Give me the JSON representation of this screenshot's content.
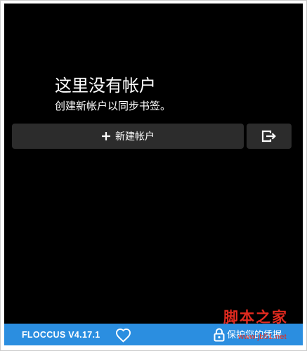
{
  "empty_state": {
    "heading": "这里没有帐户",
    "subtitle": "创建新帐户以同步书签。"
  },
  "actions": {
    "new_account_icon": "plus-icon",
    "new_account_label": "新建帐户",
    "import_icon": "box-arrow-right-icon"
  },
  "footer": {
    "version": "FLOCCUS V4.17.1",
    "donate_icon": "heart-outline-icon",
    "secure_icon": "lock-icon",
    "secure_label": "保护您的凭据"
  },
  "watermark": {
    "title": "脚本之家",
    "url": "www.jb51.net"
  },
  "colors": {
    "page_bg": "#ffffff",
    "frame_border": "#cbcbcb",
    "panel_bg": "#000000",
    "button_bg": "#2c2c2c",
    "footer_bg": "#2b8ee0",
    "text": "#ffffff",
    "watermark": "#e12a1f"
  }
}
